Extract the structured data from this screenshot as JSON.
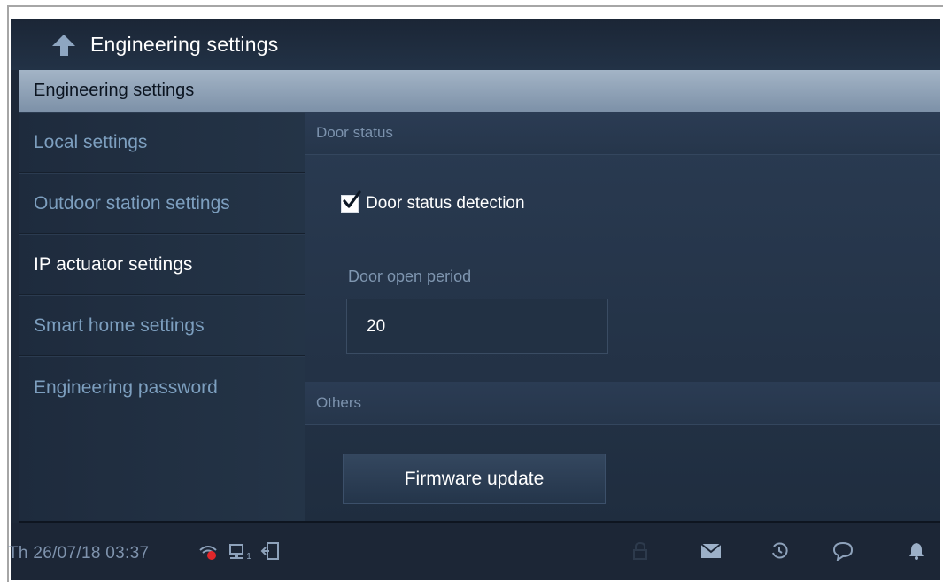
{
  "titlebar": {
    "title": "Engineering settings",
    "back_icon": "back-arrow-icon"
  },
  "section": {
    "label": "Engineering settings"
  },
  "sidebar": {
    "items": [
      {
        "label": "Local settings",
        "active": false
      },
      {
        "label": "Outdoor station settings",
        "active": false
      },
      {
        "label": "IP actuator settings",
        "active": true
      },
      {
        "label": "Smart home settings",
        "active": false
      },
      {
        "label": "Engineering password",
        "active": false
      }
    ]
  },
  "panel": {
    "door_status": {
      "header": "Door status",
      "checkbox_label": "Door status detection",
      "checked": true,
      "period_label": "Door open period",
      "period_value": "20"
    },
    "others": {
      "header": "Others",
      "firmware_button": "Firmware update"
    }
  },
  "statusbar": {
    "datetime": "Th 26/07/18  03:37",
    "network_badge": "1",
    "icons": [
      "wifi-icon",
      "network-icon",
      "exit-door-icon",
      "lock-icon",
      "mail-icon",
      "history-icon",
      "message-icon",
      "bell-icon"
    ]
  },
  "colors": {
    "background": "#1d2838",
    "section_bar": "#93a6ba",
    "text_active": "#ffffff",
    "text_inactive": "#7d9fbf",
    "wifi_alert": "#e0262a"
  }
}
